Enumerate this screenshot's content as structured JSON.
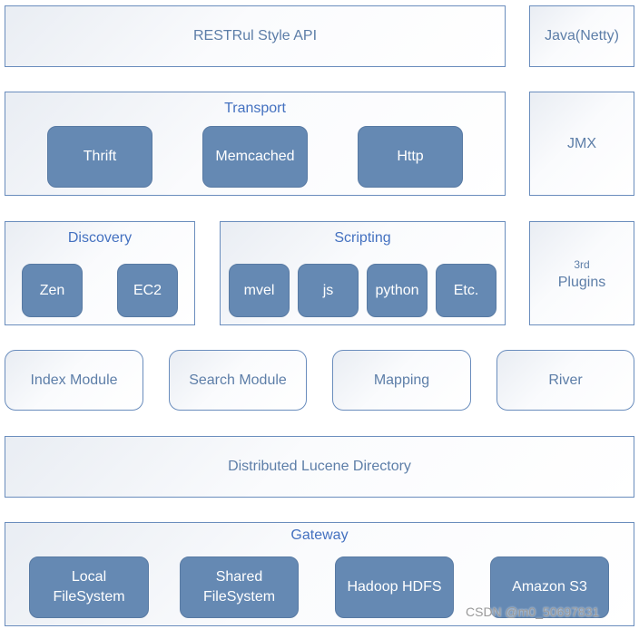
{
  "layers": {
    "rest": "RESTRul Style API",
    "java": "Java(Netty)",
    "transport": {
      "title": "Transport",
      "items": [
        "Thrift",
        "Memcached",
        "Http"
      ]
    },
    "jmx": "JMX",
    "discovery": {
      "title": "Discovery",
      "items": [
        "Zen",
        "EC2"
      ]
    },
    "scripting": {
      "title": "Scripting",
      "items": [
        "mvel",
        "js",
        "python",
        "Etc."
      ]
    },
    "plugins": {
      "sup": "3rd",
      "label": "Plugins"
    },
    "modules": [
      "Index Module",
      "Search Module",
      "Mapping",
      "River"
    ],
    "lucene": "Distributed Lucene Directory",
    "gateway": {
      "title": "Gateway",
      "items": [
        [
          "Local",
          "FileSystem"
        ],
        [
          "Shared",
          "FileSystem"
        ],
        [
          "Hadoop HDFS"
        ],
        [
          "Amazon S3"
        ]
      ]
    }
  },
  "watermark": "CSDN @m0_50697831",
  "colors": {
    "border": "#6a8dbd",
    "chip": "#6589b3",
    "title": "#4471c0",
    "text": "#5d7ea8"
  }
}
